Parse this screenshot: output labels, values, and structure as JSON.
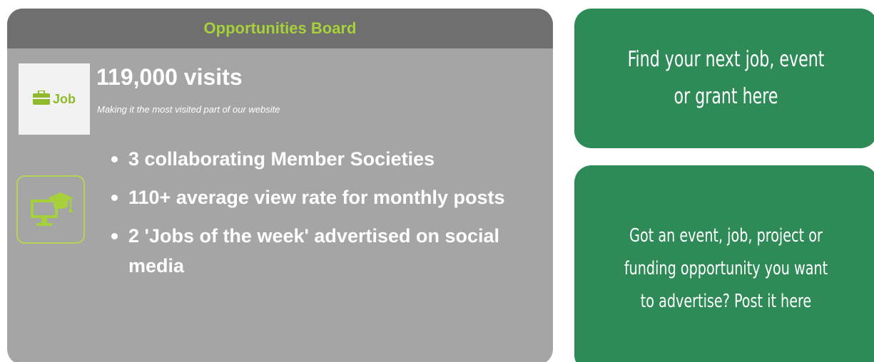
{
  "board": {
    "title": "Opportunities Board",
    "logo_label": "Job",
    "logo_icon": "briefcase-icon",
    "visits": "119,000 visits",
    "tagline": "Making it the most visited part of our website",
    "side_icon": "graduation-computer-icon",
    "bullets": [
      "3 collaborating Member Societies",
      "110+ average view rate for monthly posts",
      "2 'Jobs of the week' advertised on social media"
    ],
    "colors": {
      "panel": "#a5a5a5",
      "header": "#6f6f6f",
      "accent": "#a6d13a"
    }
  },
  "cta": {
    "find": "Find your next job, event or grant here",
    "post": "Got an event, job, project or funding opportunity you want to advertise? Post it here",
    "color": "#2e8b57"
  }
}
